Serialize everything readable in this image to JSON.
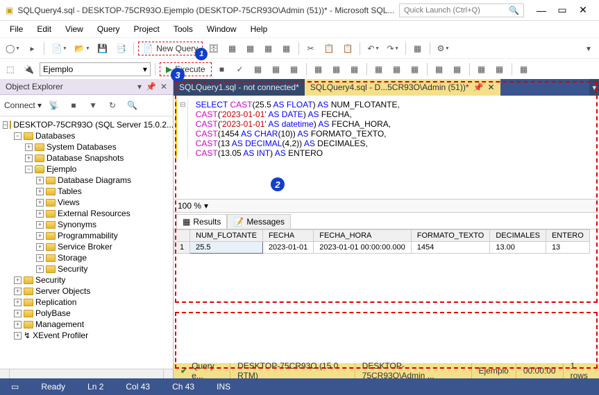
{
  "title": "SQLQuery4.sql - DESKTOP-75CR93O.Ejemplo (DESKTOP-75CR93O\\Admin (51))* - Microsoft SQL...",
  "quick_launch_placeholder": "Quick Launch (Ctrl+Q)",
  "menu": [
    "File",
    "Edit",
    "View",
    "Query",
    "Project",
    "Tools",
    "Window",
    "Help"
  ],
  "toolbar1": {
    "new_query": "New Query"
  },
  "toolbar2": {
    "db": "Ejemplo",
    "execute": "Execute"
  },
  "callouts": {
    "c1": "1",
    "c2": "2",
    "c3": "3"
  },
  "oe": {
    "title": "Object Explorer",
    "connect": "Connect ▾",
    "server": "DESKTOP-75CR93O (SQL Server 15.0.2...",
    "tree": {
      "databases": "Databases",
      "sysdb": "System Databases",
      "snap": "Database Snapshots",
      "ejemplo": "Ejemplo",
      "diagrams": "Database Diagrams",
      "tables": "Tables",
      "views": "Views",
      "extres": "External Resources",
      "syn": "Synonyms",
      "prog": "Programmability",
      "sb": "Service Broker",
      "storage": "Storage",
      "sec": "Security",
      "security2": "Security",
      "serverobj": "Server Objects",
      "repl": "Replication",
      "poly": "PolyBase",
      "mgmt": "Management",
      "xevent": "XEvent Profiler"
    }
  },
  "tabs": {
    "t1": "SQLQuery1.sql - not connected*",
    "t2": "SQLQuery4.sql - D...5CR93O\\Admin (51))*"
  },
  "zoom": "100 %",
  "results": {
    "results_tab": "Results",
    "messages_tab": "Messages",
    "headers": [
      "",
      "NUM_FLOTANTE",
      "FECHA",
      "FECHA_HORA",
      "FORMATO_TEXTO",
      "DECIMALES",
      "ENTERO"
    ],
    "row1": [
      "1",
      "25.5",
      "2023-01-01",
      "2023-01-01 00:00:00.000",
      "1454",
      "13.00",
      "13"
    ]
  },
  "status": {
    "q": "Query e...",
    "srv": "DESKTOP-75CR93O (15.0 RTM)",
    "usr": "DESKTOP-75CR93O\\Admin ...",
    "db": "Ejemplo",
    "time": "00:00:00",
    "rows": "1 rows"
  },
  "status2": {
    "ready": "Ready",
    "ln": "Ln 2",
    "col": "Col 43",
    "ch": "Ch 43",
    "ins": "INS"
  }
}
